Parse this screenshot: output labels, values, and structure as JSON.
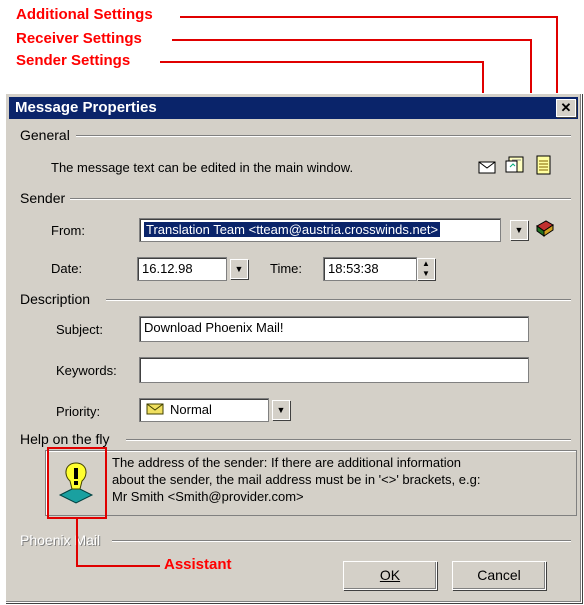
{
  "callouts": {
    "additional_settings": "Additional Settings",
    "receiver_settings": "Receiver Settings",
    "sender_settings": "Sender Settings",
    "assistant": "Assistant"
  },
  "window": {
    "title": "Message Properties",
    "close_glyph": "✕"
  },
  "general": {
    "heading": "General",
    "text": "The message text can be edited in the main window."
  },
  "sender": {
    "heading": "Sender",
    "from_label": "From:",
    "from_value": "Translation Team <tteam@austria.crosswinds.net>",
    "date_label": "Date:",
    "date_value": "16.12.98",
    "time_label": "Time:",
    "time_value": "18:53:38"
  },
  "description": {
    "heading": "Description",
    "subject_label": "Subject:",
    "subject_value": "Download Phoenix Mail!",
    "keywords_label": "Keywords:",
    "keywords_value": "",
    "priority_label": "Priority:",
    "priority_value": "Normal"
  },
  "help": {
    "heading": "Help on the fly",
    "line1": "The address of the sender: If there are additional information",
    "line2": "about the sender, the mail address must be in '<>' brackets, e.g:",
    "line3": "Mr Smith <Smith@provider.com>"
  },
  "footer": {
    "group_label": "Phoenix Mail",
    "ok_label": "OK",
    "cancel_label": "Cancel"
  },
  "colors": {
    "title_bar": "#0a246a",
    "dialog_bg": "#d4d0c8",
    "annotation": "#ff0000"
  }
}
